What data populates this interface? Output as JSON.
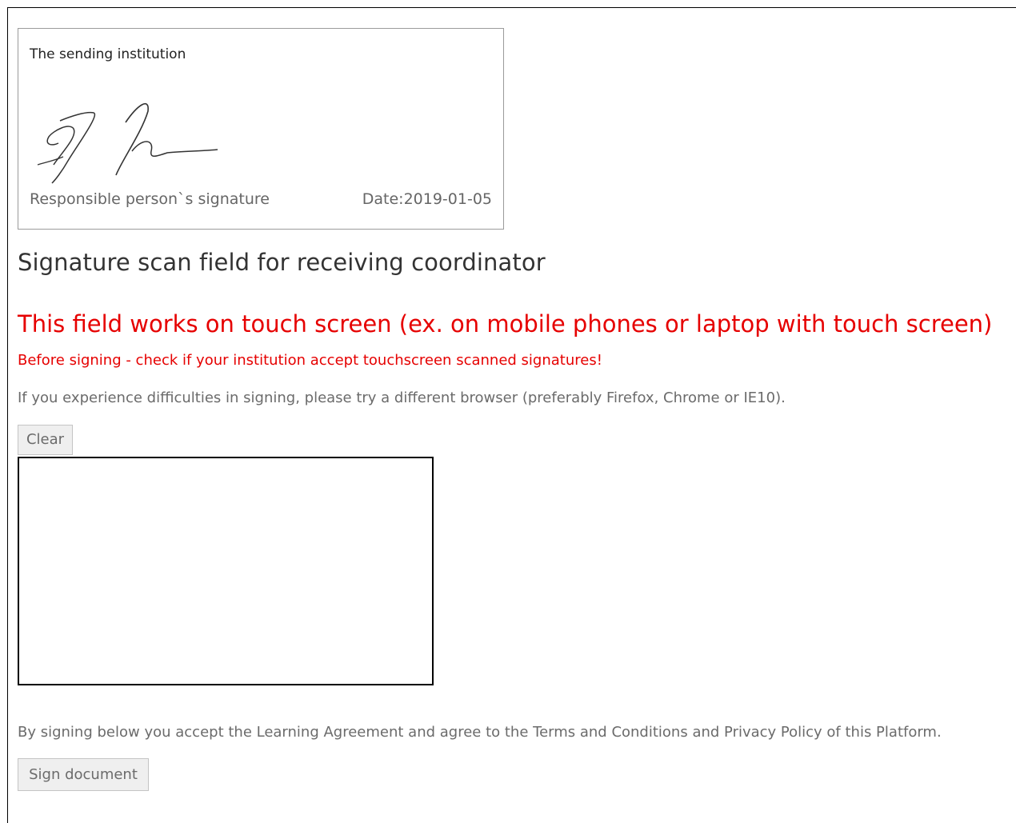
{
  "signature_card": {
    "institution": "The sending institution",
    "responsible_label": "Responsible person`s signature",
    "date_text": "Date:2019-01-05"
  },
  "heading": "Signature scan field for receiving coordinator",
  "warning_touch": "This field works on touch screen (ex. on mobile phones or laptop with touch screen)",
  "warning_check": "Before signing - check if your institution accept touchscreen scanned signatures!",
  "hint": "If you experience difficulties in signing, please try a different browser (preferably Firefox, Chrome or IE10).",
  "clear_button": "Clear",
  "terms": "By signing below you accept the Learning Agreement and agree to the Terms and Conditions and Privacy Policy of this Platform.",
  "sign_button": "Sign document",
  "colors": {
    "warning": "#e60000",
    "muted_text": "#6b6b6b",
    "heading": "#333333"
  }
}
